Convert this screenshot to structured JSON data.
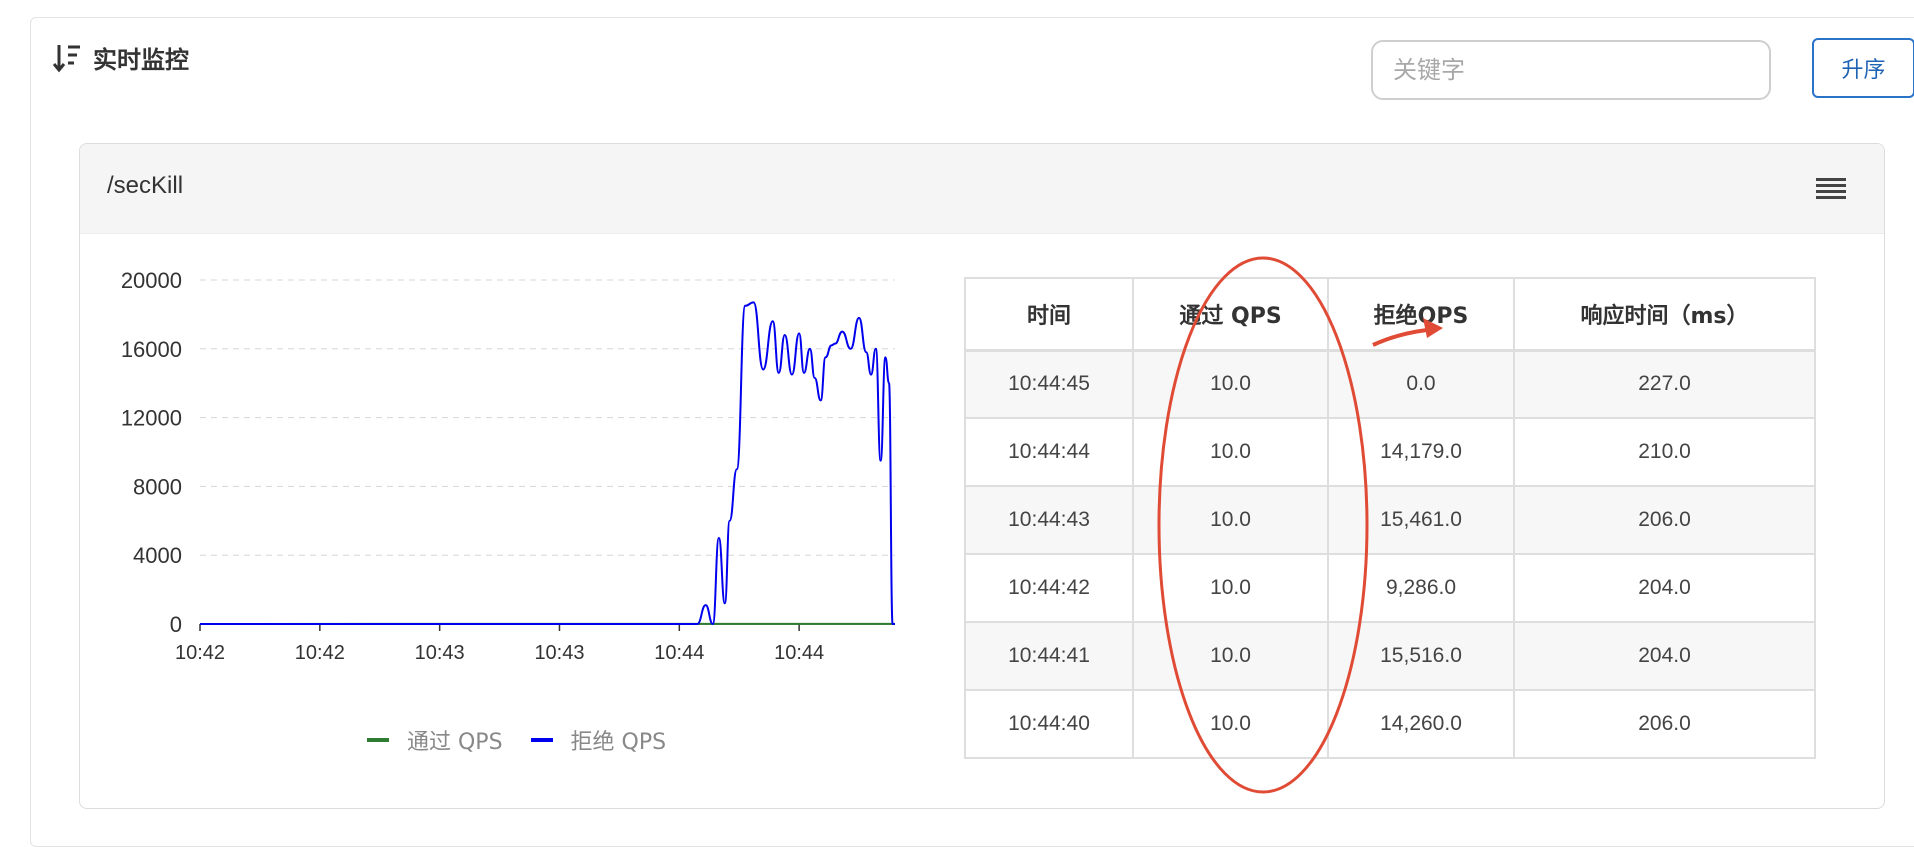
{
  "panel": {
    "title": "实时监控",
    "sort_icon": "sort-desc-icon"
  },
  "search": {
    "placeholder": "关键字",
    "value": ""
  },
  "sort_button": {
    "label": "升序"
  },
  "card": {
    "title": "/secKill",
    "menu_icon": "hamburger-menu-icon"
  },
  "chart_data": {
    "type": "line",
    "x_tick_labels": [
      "10:42",
      "10:42",
      "10:43",
      "10:43",
      "10:44",
      "10:44"
    ],
    "ylim": [
      0,
      20000
    ],
    "y_ticks": [
      0,
      4000,
      8000,
      12000,
      16000,
      20000
    ],
    "grid": true,
    "legend_position": "bottom",
    "series": [
      {
        "name": "通过 QPS",
        "color": "#2e7d32",
        "x": [
          0,
          4.15,
          5.8
        ],
        "y": [
          0,
          10,
          10
        ]
      },
      {
        "name": "拒绝 QPS",
        "color": "#0000ee",
        "x": [
          0,
          4.15,
          4.22,
          4.28,
          4.33,
          4.38,
          4.42,
          4.48,
          4.55,
          4.62,
          4.7,
          4.78,
          4.83,
          4.88,
          4.94,
          5.0,
          5.04,
          5.09,
          5.13,
          5.18,
          5.22,
          5.27,
          5.3,
          5.36,
          5.43,
          5.5,
          5.56,
          5.6,
          5.64,
          5.68,
          5.72,
          5.75,
          5.78,
          5.8
        ],
        "y": [
          0,
          0,
          1100,
          0,
          5000,
          1200,
          6000,
          9000,
          18500,
          18700,
          14800,
          17600,
          14600,
          16800,
          14500,
          16900,
          14600,
          16000,
          14300,
          13000,
          15500,
          16200,
          16300,
          17000,
          16000,
          17800,
          15800,
          14500,
          16000,
          9500,
          15500,
          14000,
          0,
          0
        ]
      }
    ]
  },
  "table": {
    "headers": [
      "时间",
      "通过 QPS",
      "拒绝QPS",
      "响应时间（ms）"
    ],
    "rows": [
      [
        "10:44:45",
        "10.0",
        "0.0",
        "227.0"
      ],
      [
        "10:44:44",
        "10.0",
        "14,179.0",
        "210.0"
      ],
      [
        "10:44:43",
        "10.0",
        "15,461.0",
        "206.0"
      ],
      [
        "10:44:42",
        "10.0",
        "9,286.0",
        "204.0"
      ],
      [
        "10:44:41",
        "10.0",
        "15,516.0",
        "204.0"
      ],
      [
        "10:44:40",
        "10.0",
        "14,260.0",
        "206.0"
      ]
    ]
  },
  "annotation": {
    "color": "#e04b35"
  }
}
